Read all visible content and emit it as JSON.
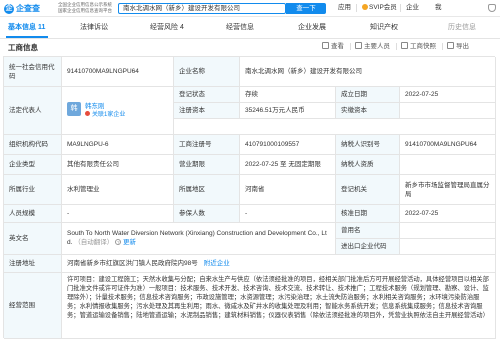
{
  "header": {
    "logo_text": "企查查",
    "slogan_line1": "全国企业信用信息公示系统",
    "slogan_line2": "国家企业信用信息查询平台",
    "search_value": "南水北调水网（新乡）建设开发有限公司",
    "search_button": "查一下",
    "links": {
      "apply": "应用",
      "svip": "SVIP会员",
      "enterprise": "企业",
      "me": "我"
    }
  },
  "tabs": [
    {
      "label": "基本信息",
      "count": "11"
    },
    {
      "label": "法律诉讼",
      "count": ""
    },
    {
      "label": "经营风险",
      "count": "4"
    },
    {
      "label": "经营信息",
      "count": ""
    },
    {
      "label": "企业发展",
      "count": ""
    },
    {
      "label": "知识产权",
      "count": ""
    },
    {
      "label": "历史信息",
      "count": ""
    }
  ],
  "section": {
    "title": "工商信息",
    "toolbar": [
      "查看",
      "主要人员",
      "工商快照",
      "导出"
    ]
  },
  "info": {
    "credit_code_label": "统一社会信用代码",
    "credit_code": "91410700MA9LNGPU64",
    "company_name_label": "企业名称",
    "company_name": "南水北调水网（新乡）建设开发有限公司",
    "legal_rep_label": "法定代表人",
    "legal_rep_avatar": "韩",
    "legal_rep_name": "韩东刚",
    "legal_rep_related": "关联1家企业",
    "reg_status_label": "登记状态",
    "reg_status": "存续",
    "est_date_label": "成立日期",
    "est_date": "2022-07-25",
    "reg_capital_label": "注册资本",
    "reg_capital": "35246.51万元人民币",
    "paid_capital_label": "实缴资本",
    "paid_capital": "",
    "org_code_label": "组织机构代码",
    "org_code": "MA9LNGPU-6",
    "biz_reg_no_label": "工商注册号",
    "biz_reg_no": "410791000109557",
    "taxpayer_id_label": "纳税人识别号",
    "taxpayer_id": "91410700MA9LNGPU64",
    "company_type_label": "企业类型",
    "company_type": "其他有限责任公司",
    "biz_term_label": "营业期限",
    "biz_term": "2022-07-25 至 无固定期限",
    "taxpayer_qual_label": "纳税人资质",
    "taxpayer_qual": "",
    "industry_label": "所属行业",
    "industry": "水利管理业",
    "region_label": "所属地区",
    "region": "河南省",
    "reg_authority_label": "登记机关",
    "reg_authority": "新乡市市场监督管理局直属分局",
    "staff_label": "人员规模",
    "staff": "-",
    "insured_label": "参保人数",
    "insured": "-",
    "approval_date_label": "核准日期",
    "approval_date": "2022-07-25",
    "en_name_label": "英文名",
    "en_name": "South To North Water Diversion Network (Xinxiang) Construction and Development Co., Ltd.",
    "en_name_note": "（自动翻译）",
    "en_name_update": "更新",
    "former_name_label": "曾用名",
    "former_name": "",
    "import_export_label": "进出口企业代码",
    "import_export": "",
    "address_label": "注册地址",
    "address": "河南省新乡市红旗区洪门镇人民政府院内98号",
    "address_link": "附近企业",
    "scope_label": "经营范围",
    "scope": "许可项目：建设工程施工；天然水收集与分配；自来水生产与供应（依法须经批准的项目，经相关部门批准后方可开展经营活动，具体经营项目以相关部门批准文件或许可证件为准）一般项目：技术服务、技术开发、技术咨询、技术交流、技术转让、技术推广；工程技术服务（规划管理、勘察、设计、监理除外）；计量技术服务；信息技术咨询服务；市政设施管理；水资源管理；水污染治理；水土流失防治服务；水利相关咨询服务；水环境污染防治服务；水利情报收集服务；污水处理及其再生利用；雨水、微咸水及矿井水的收集处理及利用；智能水务系统开发；信息系统集成服务；信息技术咨询服务；管道运输设备销售；陆地管道运输；水泥制品销售；建筑材料销售；仪器仪表销售（除依法须经批准的项目外，凭营业执照依法自主开展经营活动）"
  },
  "colors": {
    "brand": "#128bed",
    "label_bg": "#f2f9fc",
    "border": "#e4e4e4"
  }
}
